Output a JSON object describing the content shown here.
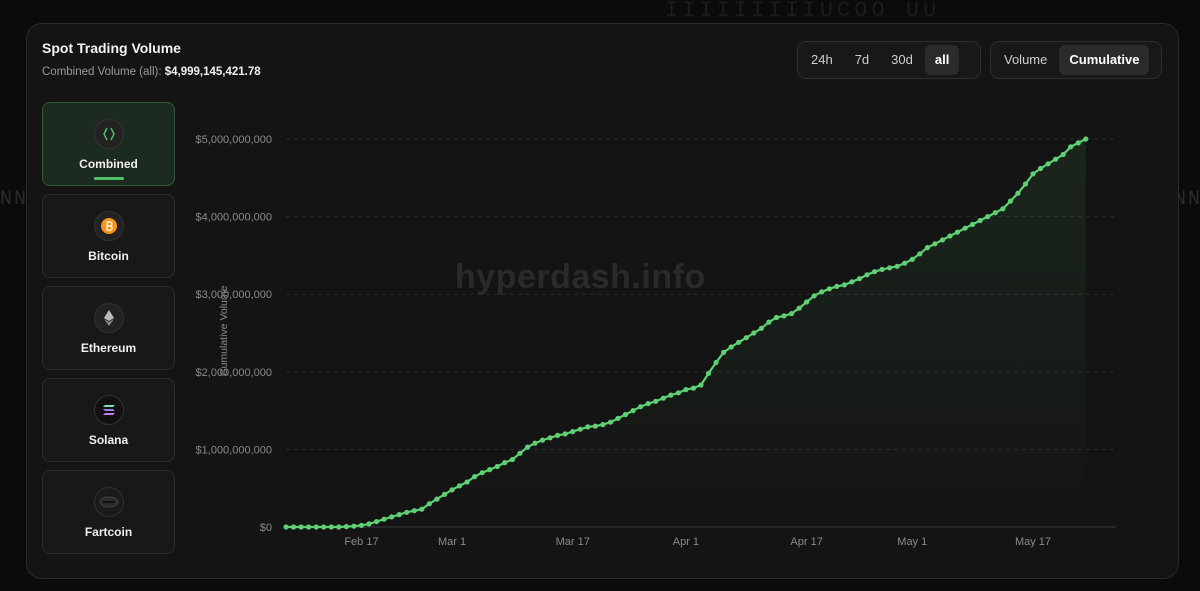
{
  "background": {
    "top_glyphs": "IIIIIIIIIUCOO UU",
    "left_glyphs": "NN",
    "right_glyphs": "NN"
  },
  "header": {
    "title": "Spot Trading Volume",
    "subtitle_label": "Combined Volume (all):",
    "subtitle_value": "$4,999,145,421.78"
  },
  "range_tabs": [
    {
      "label": "24h",
      "active": false
    },
    {
      "label": "7d",
      "active": false
    },
    {
      "label": "30d",
      "active": false
    },
    {
      "label": "all",
      "active": true
    }
  ],
  "mode_tabs": [
    {
      "label": "Volume",
      "active": false
    },
    {
      "label": "Cumulative",
      "active": true
    }
  ],
  "assets": [
    {
      "label": "Combined",
      "icon": "combined-icon",
      "active": true
    },
    {
      "label": "Bitcoin",
      "icon": "bitcoin-icon",
      "active": false
    },
    {
      "label": "Ethereum",
      "icon": "ethereum-icon",
      "active": false
    },
    {
      "label": "Solana",
      "icon": "solana-icon",
      "active": false
    },
    {
      "label": "Fartcoin",
      "icon": "fartcoin-icon",
      "active": false
    }
  ],
  "colors": {
    "accent": "#4fc26a",
    "line": "#5fd074",
    "bitcoin": "#f7931a"
  },
  "watermark": "hyperdash.info",
  "chart_data": {
    "type": "area",
    "title": "",
    "xlabel": "",
    "ylabel": "Cumulative Volume",
    "x_ticks": [
      "Feb 17",
      "Mar 1",
      "Mar 17",
      "Apr 1",
      "Apr 17",
      "May 1",
      "May 17"
    ],
    "y_ticks": [
      "$0",
      "$1,000,000,000",
      "$2,000,000,000",
      "$3,000,000,000",
      "$4,000,000,000",
      "$5,000,000,000"
    ],
    "ylim": [
      0,
      5000000000
    ],
    "xlim": [
      "2025-02-07",
      "2025-05-28"
    ],
    "grid": "horizontal-dashed",
    "series": [
      {
        "x": [
          "2025-02-07",
          "2025-02-08",
          "2025-02-09",
          "2025-02-10",
          "2025-02-11",
          "2025-02-12",
          "2025-02-13",
          "2025-02-14",
          "2025-02-15",
          "2025-02-16",
          "2025-02-17",
          "2025-02-18",
          "2025-02-19",
          "2025-02-20",
          "2025-02-21",
          "2025-02-22",
          "2025-02-23",
          "2025-02-24",
          "2025-02-25",
          "2025-02-26",
          "2025-02-27",
          "2025-02-28",
          "2025-03-01",
          "2025-03-02",
          "2025-03-03",
          "2025-03-04",
          "2025-03-05",
          "2025-03-06",
          "2025-03-07",
          "2025-03-08",
          "2025-03-09",
          "2025-03-10",
          "2025-03-11",
          "2025-03-12",
          "2025-03-13",
          "2025-03-14",
          "2025-03-15",
          "2025-03-16",
          "2025-03-17",
          "2025-03-18",
          "2025-03-19",
          "2025-03-20",
          "2025-03-21",
          "2025-03-22",
          "2025-03-23",
          "2025-03-24",
          "2025-03-25",
          "2025-03-26",
          "2025-03-27",
          "2025-03-28",
          "2025-03-29",
          "2025-03-30",
          "2025-03-31",
          "2025-04-01",
          "2025-04-02",
          "2025-04-03",
          "2025-04-04",
          "2025-04-05",
          "2025-04-06",
          "2025-04-07",
          "2025-04-08",
          "2025-04-09",
          "2025-04-10",
          "2025-04-11",
          "2025-04-12",
          "2025-04-13",
          "2025-04-14",
          "2025-04-15",
          "2025-04-16",
          "2025-04-17",
          "2025-04-18",
          "2025-04-19",
          "2025-04-20",
          "2025-04-21",
          "2025-04-22",
          "2025-04-23",
          "2025-04-24",
          "2025-04-25",
          "2025-04-26",
          "2025-04-27",
          "2025-04-28",
          "2025-04-29",
          "2025-04-30",
          "2025-05-01",
          "2025-05-02",
          "2025-05-03",
          "2025-05-04",
          "2025-05-05",
          "2025-05-06",
          "2025-05-07",
          "2025-05-08",
          "2025-05-09",
          "2025-05-10",
          "2025-05-11",
          "2025-05-12",
          "2025-05-13",
          "2025-05-14",
          "2025-05-15",
          "2025-05-16",
          "2025-05-17",
          "2025-05-18",
          "2025-05-19",
          "2025-05-20",
          "2025-05-21",
          "2025-05-22",
          "2025-05-23",
          "2025-05-24"
        ],
        "values": [
          0,
          0,
          0,
          0,
          0,
          0,
          0,
          0,
          5000000,
          10000000,
          20000000,
          40000000,
          70000000,
          100000000,
          130000000,
          160000000,
          190000000,
          210000000,
          230000000,
          300000000,
          360000000,
          420000000,
          480000000,
          530000000,
          580000000,
          650000000,
          700000000,
          740000000,
          780000000,
          830000000,
          870000000,
          950000000,
          1030000000,
          1080000000,
          1120000000,
          1150000000,
          1180000000,
          1200000000,
          1230000000,
          1260000000,
          1290000000,
          1300000000,
          1320000000,
          1350000000,
          1400000000,
          1450000000,
          1500000000,
          1550000000,
          1590000000,
          1620000000,
          1660000000,
          1700000000,
          1730000000,
          1770000000,
          1790000000,
          1830000000,
          1980000000,
          2120000000,
          2250000000,
          2320000000,
          2380000000,
          2440000000,
          2500000000,
          2560000000,
          2640000000,
          2700000000,
          2720000000,
          2750000000,
          2820000000,
          2900000000,
          2980000000,
          3030000000,
          3070000000,
          3100000000,
          3120000000,
          3160000000,
          3200000000,
          3250000000,
          3290000000,
          3320000000,
          3340000000,
          3360000000,
          3400000000,
          3450000000,
          3520000000,
          3600000000,
          3650000000,
          3700000000,
          3750000000,
          3800000000,
          3850000000,
          3900000000,
          3950000000,
          4000000000,
          4050000000,
          4100000000,
          4200000000,
          4300000000,
          4420000000,
          4550000000,
          4620000000,
          4680000000,
          4740000000,
          4800000000,
          4900000000,
          4950000000,
          5000000000
        ]
      }
    ]
  }
}
